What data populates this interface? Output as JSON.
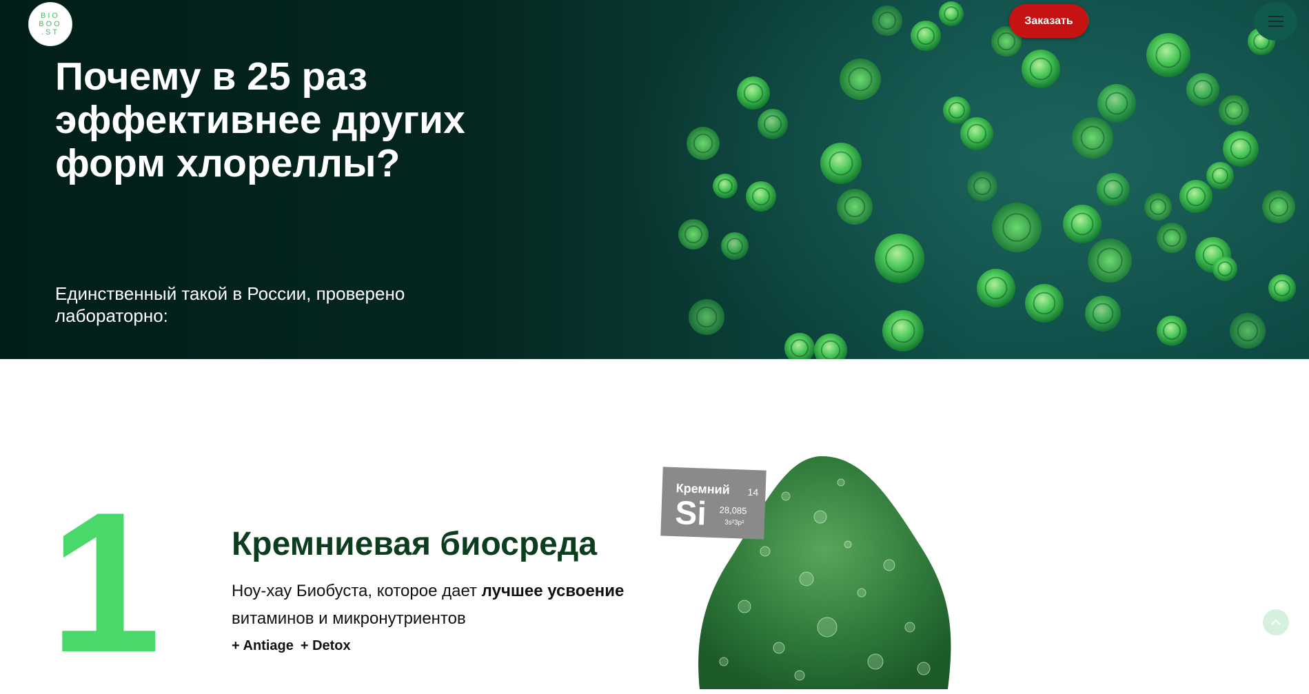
{
  "header": {
    "logo_text": "BIO BOO .ST",
    "order_label": "Заказать",
    "menu_icon": "hamburger-icon"
  },
  "hero": {
    "title": "Почему в 25 раз эффективнее других форм хлореллы?",
    "subtitle": "Единственный такой в России, проверено лабораторно:"
  },
  "section": {
    "number": "1",
    "title": "Кремниевая биосреда",
    "desc_before": "Ноу-хау Биобуста, которое дает ",
    "desc_bold": "лучшее усвоение",
    "desc_after": " витаминов и микронутриентов",
    "tags": [
      "+ Antiage",
      "+ Detox"
    ]
  },
  "element_card": {
    "name": "Кремний",
    "atomic_number": "14",
    "symbol": "Si",
    "mass": "28,085",
    "config": "3s²3p²"
  },
  "colors": {
    "accent_green": "#4bd86a",
    "title_green": "#0d3d1f",
    "order_red": "#c51212"
  }
}
